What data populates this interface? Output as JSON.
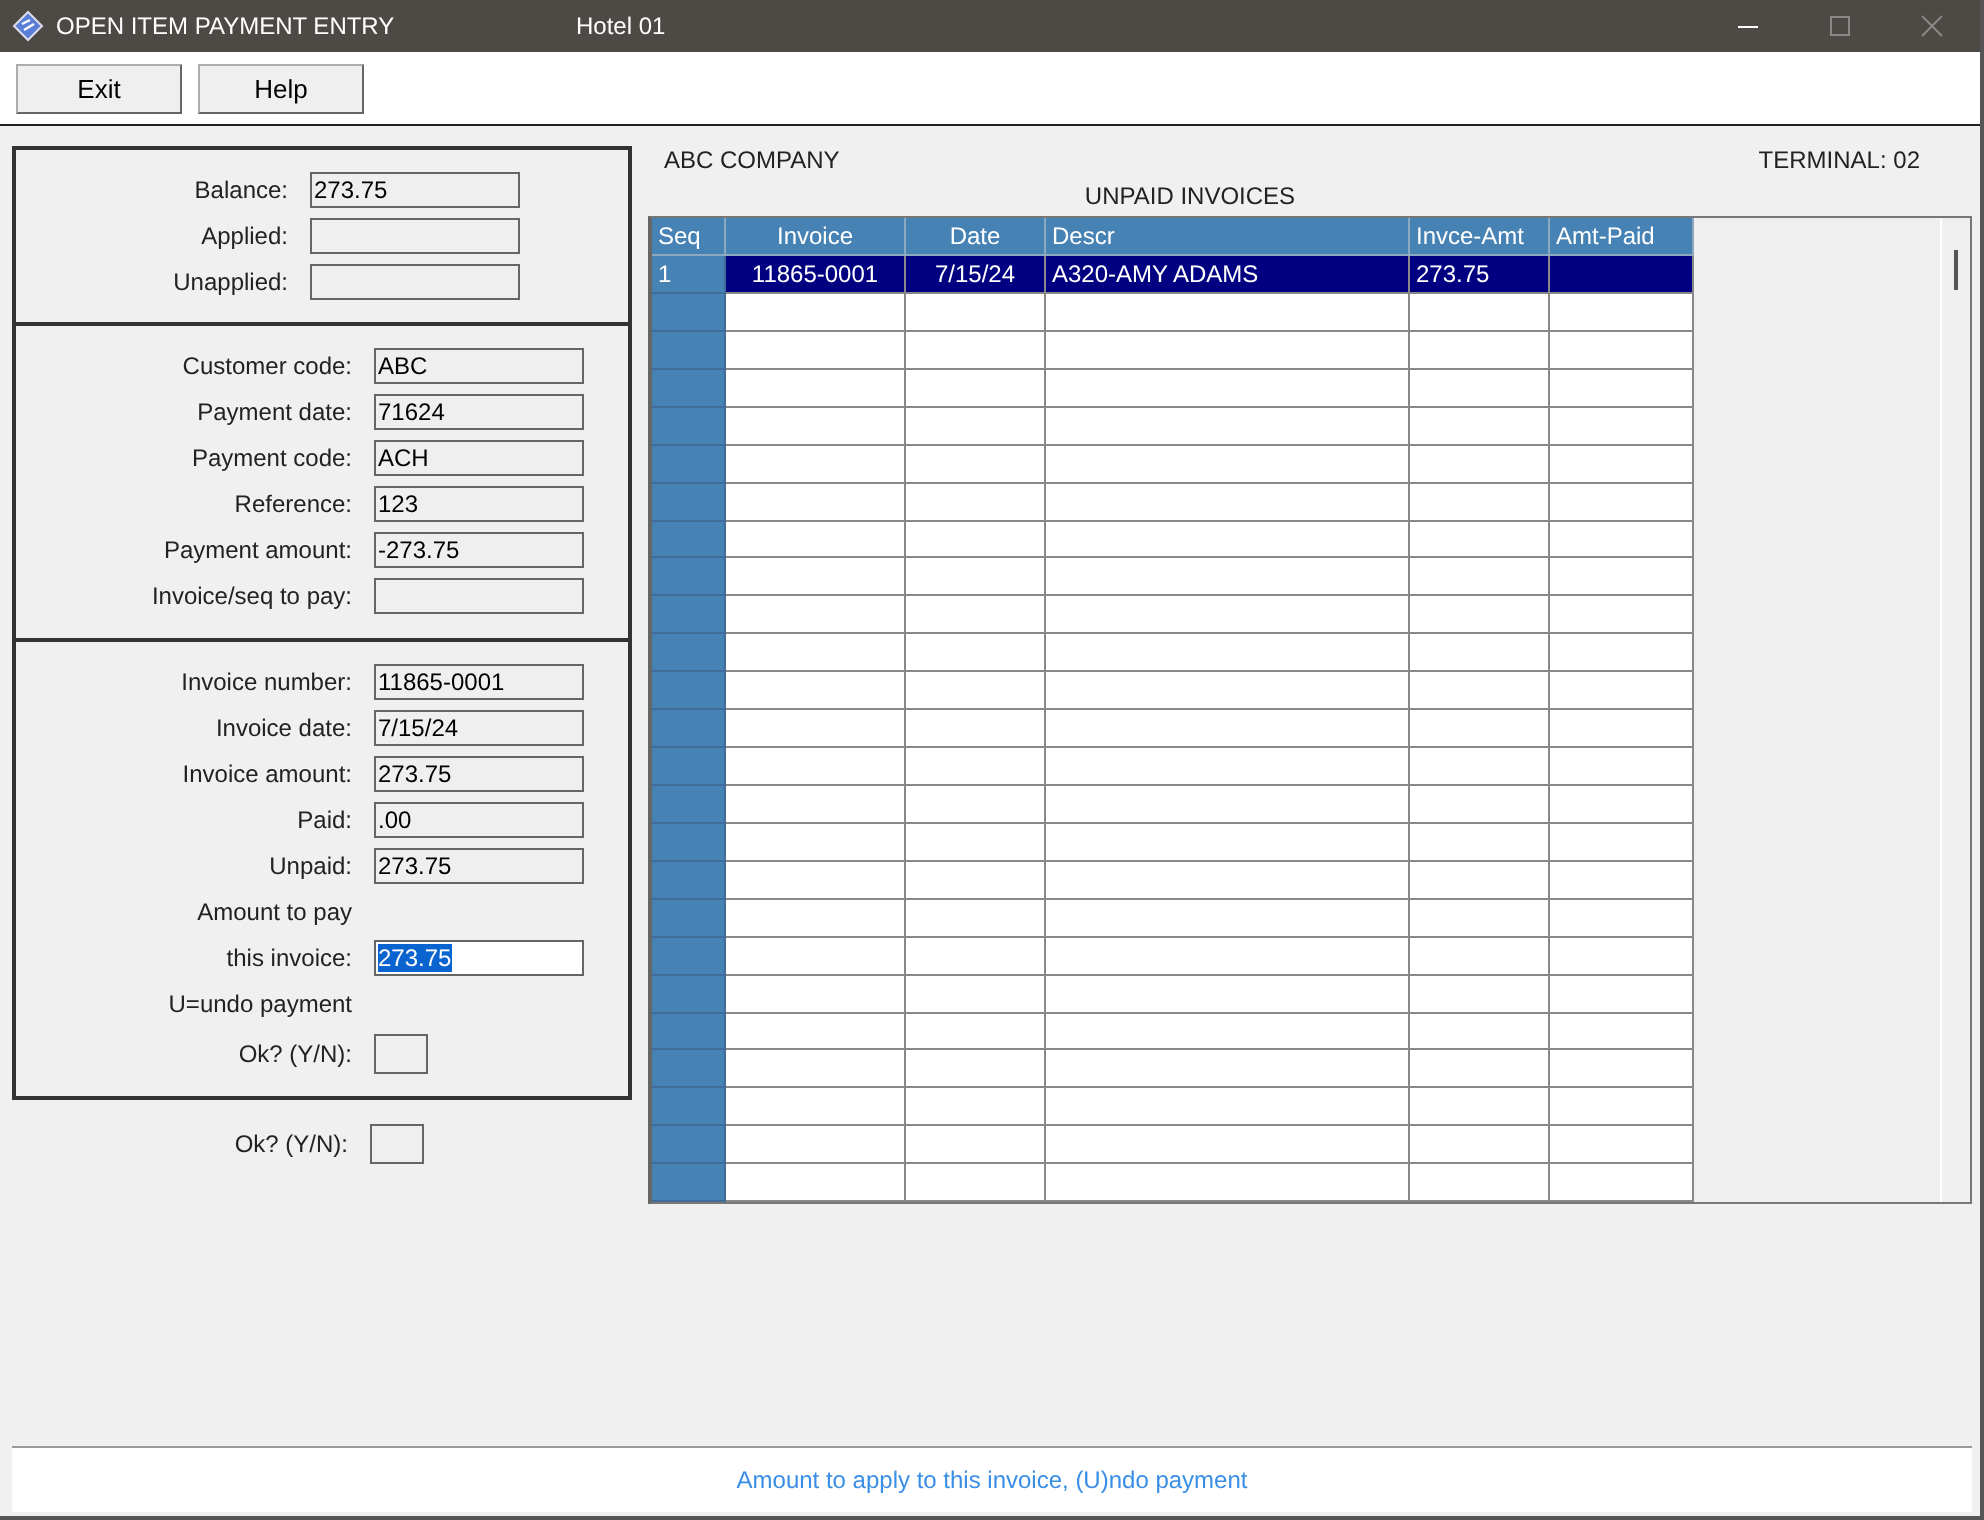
{
  "window": {
    "title": "OPEN ITEM PAYMENT ENTRY",
    "subtitle": "Hotel 01"
  },
  "toolbar": [
    {
      "label": "Exit"
    },
    {
      "label": "Help"
    }
  ],
  "totals": [
    {
      "label": "Balance:",
      "value": "273.75"
    },
    {
      "label": "Applied:"
    },
    {
      "label": "Unapplied:"
    }
  ],
  "payment": [
    {
      "label": "Customer code:",
      "value": "ABC"
    },
    {
      "label": "Payment date:",
      "value": "71624"
    },
    {
      "label": "Payment code:",
      "value": "ACH"
    },
    {
      "label": "Reference:",
      "value": "123"
    },
    {
      "label": "Payment amount:",
      "value": "-273.75"
    },
    {
      "label": "Invoice/seq to pay:"
    }
  ],
  "invoice": [
    {
      "kind": "field",
      "label": "Invoice number:",
      "value": "11865-0001"
    },
    {
      "kind": "field",
      "label": "Invoice date:",
      "value": "7/15/24"
    },
    {
      "kind": "field",
      "label": "Invoice amount:",
      "value": "273.75"
    },
    {
      "kind": "field",
      "label": "Paid:",
      "value": ".00"
    },
    {
      "kind": "field",
      "label": "Unpaid:",
      "value": "273.75"
    },
    {
      "kind": "note",
      "label": "Amount to pay"
    },
    {
      "kind": "input",
      "label": "this invoice:",
      "value": "273.75",
      "text_selected": true
    },
    {
      "kind": "note",
      "label": "U=undo payment"
    },
    {
      "kind": "small",
      "label": "Ok? (Y/N):"
    }
  ],
  "confirm": {
    "label": "Ok? (Y/N):"
  },
  "company": "ABC COMPANY",
  "terminal": "TERMINAL: 02",
  "table": {
    "title": "UNPAID INVOICES",
    "columns": [
      "Seq",
      "Invoice",
      "Date",
      "Descr",
      "Invce-Amt",
      "Amt-Paid"
    ],
    "rows": [
      {
        "cells": [
          "1",
          "11865-0001",
          "7/15/24",
          "A320-AMY ADAMS",
          "273.75"
        ],
        "selected": true
      }
    ]
  },
  "status_bar": "Amount to apply to this invoice, (U)ndo payment"
}
